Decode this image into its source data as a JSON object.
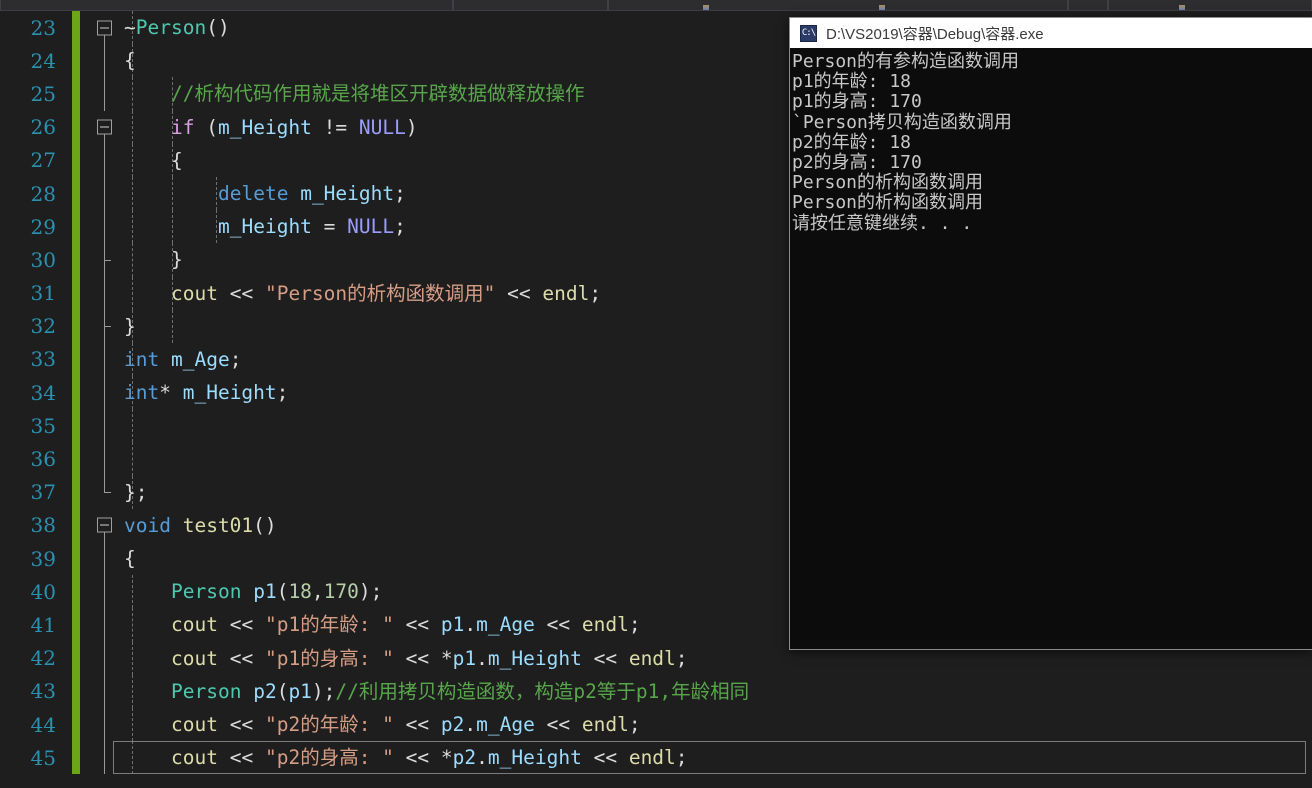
{
  "window": {
    "background_color": "#1e1e1e",
    "accent_color": "#2b91af"
  },
  "top_toolbar": {
    "visible_fragment": true,
    "note": "partially cut-off toolbar strip"
  },
  "editor": {
    "first_line_number": 23,
    "current_line": 45,
    "change_bar_color": "#6ca516",
    "line_number_color": "#2b91af",
    "lines": [
      {
        "n": 23,
        "fold": "collapse",
        "code": "~Person()"
      },
      {
        "n": 24,
        "fold": "line",
        "code": "{"
      },
      {
        "n": 25,
        "fold": "line",
        "code": "    //析构代码作用就是将堆区开辟数据做释放操作"
      },
      {
        "n": 26,
        "fold": "collapse",
        "code": "    if (m_Height != NULL)"
      },
      {
        "n": 27,
        "fold": "line",
        "code": "    {"
      },
      {
        "n": 28,
        "fold": "line",
        "code": "        delete m_Height;"
      },
      {
        "n": 29,
        "fold": "line",
        "code": "        m_Height = NULL;"
      },
      {
        "n": 30,
        "fold": "tick",
        "code": "    }"
      },
      {
        "n": 31,
        "fold": "line",
        "code": "    cout << \"Person的析构函数调用\" << endl;"
      },
      {
        "n": 32,
        "fold": "tick",
        "code": "}"
      },
      {
        "n": 33,
        "fold": "line",
        "code": "int m_Age;"
      },
      {
        "n": 34,
        "fold": "line",
        "code": "int* m_Height;"
      },
      {
        "n": 35,
        "fold": "line",
        "code": ""
      },
      {
        "n": 36,
        "fold": "line",
        "code": ""
      },
      {
        "n": 37,
        "fold": "end",
        "code": "};"
      },
      {
        "n": 38,
        "fold": "collapse",
        "code": "void test01()"
      },
      {
        "n": 39,
        "fold": "line",
        "code": "{"
      },
      {
        "n": 40,
        "fold": "line",
        "code": "    Person p1(18,170);"
      },
      {
        "n": 41,
        "fold": "line",
        "code": "    cout << \"p1的年龄: \" << p1.m_Age << endl;"
      },
      {
        "n": 42,
        "fold": "line",
        "code": "    cout << \"p1的身高: \" << *p1.m_Height << endl;"
      },
      {
        "n": 43,
        "fold": "line",
        "code": "    Person p2(p1);//利用拷贝构造函数，构造p2等于p1,年龄相同"
      },
      {
        "n": 44,
        "fold": "line",
        "code": "    cout << \"p2的年龄: \" << p2.m_Age << endl;"
      },
      {
        "n": 45,
        "fold": "line",
        "code": "    cout << \"p2的身高: \" << *p2.m_Height << endl;"
      }
    ]
  },
  "console": {
    "title": "D:\\VS2019\\容器\\Debug\\容器.exe",
    "icon_label": "C:\\",
    "background_color": "#0c0c0c",
    "text_color": "#c8c8c8",
    "output_lines": [
      "Person的有参构造函数调用",
      "p1的年龄: 18",
      "p1的身高: 170",
      "`Person拷贝构造函数调用",
      "p2的年龄: 18",
      "p2的身高: 170",
      "Person的析构函数调用",
      "Person的析构函数调用",
      "请按任意键继续. . ."
    ]
  }
}
